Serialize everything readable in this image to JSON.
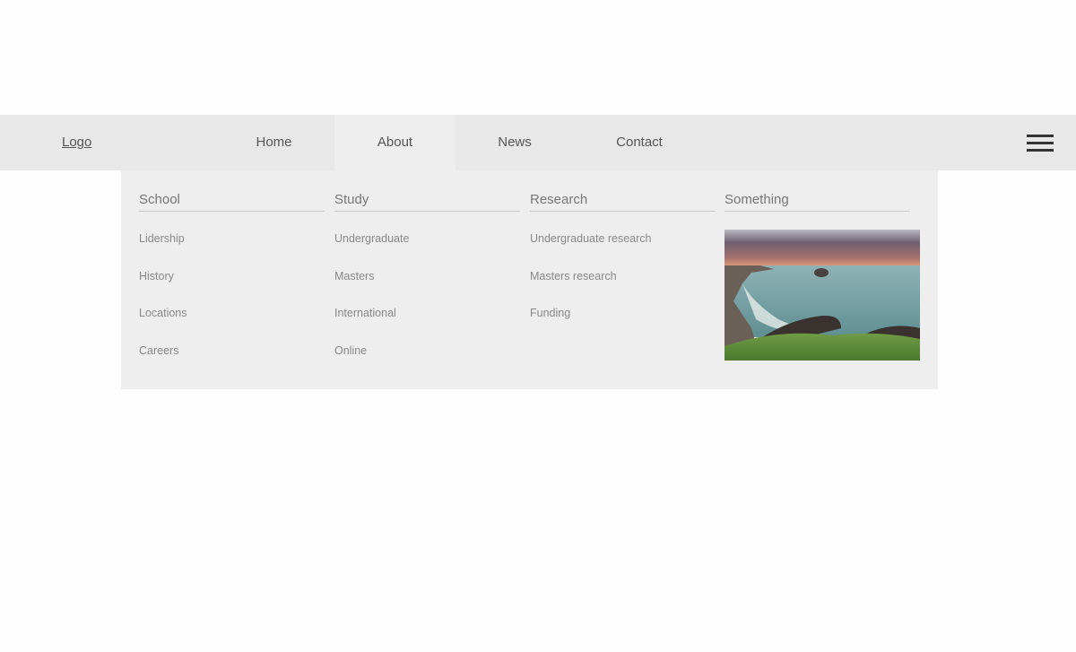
{
  "navbar": {
    "logo": "Logo",
    "items": [
      {
        "label": "Home",
        "active": false
      },
      {
        "label": "About",
        "active": true
      },
      {
        "label": "News",
        "active": false
      },
      {
        "label": "Contact",
        "active": false
      }
    ],
    "menu_icon": "hamburger-icon"
  },
  "mega_menu": {
    "columns": [
      {
        "title": "School",
        "links": [
          "Lidership",
          "History",
          "Locations",
          "Careers"
        ]
      },
      {
        "title": "Study",
        "links": [
          "Undergraduate",
          "Masters",
          "International",
          "Online"
        ]
      },
      {
        "title": "Research",
        "links": [
          "Undergraduate research",
          "Masters research",
          "Funding"
        ]
      },
      {
        "title": "Something",
        "image": "coastal-sunset-image"
      }
    ]
  }
}
